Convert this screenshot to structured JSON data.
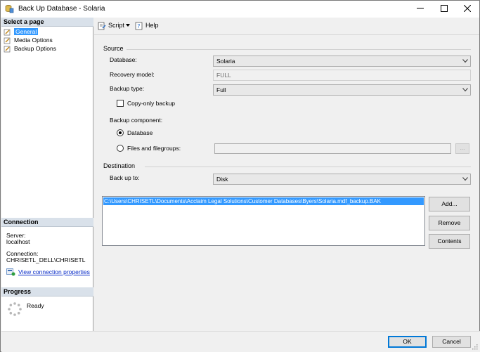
{
  "window": {
    "title": "Back Up Database - Solaria"
  },
  "sidebar": {
    "select_page_header": "Select a page",
    "pages": [
      {
        "label": "General",
        "selected": true
      },
      {
        "label": "Media Options",
        "selected": false
      },
      {
        "label": "Backup Options",
        "selected": false
      }
    ],
    "connection": {
      "header": "Connection",
      "server_label": "Server:",
      "server_value": "localhost",
      "connection_label": "Connection:",
      "connection_value": "CHRISETL_DELL\\CHRISETL",
      "view_link": "View connection properties"
    },
    "progress": {
      "header": "Progress",
      "status": "Ready"
    }
  },
  "toolbar": {
    "script_label": "Script",
    "help_label": "Help"
  },
  "source": {
    "section_label": "Source",
    "database_label": "Database:",
    "database_value": "Solaria",
    "recovery_label": "Recovery model:",
    "recovery_value": "FULL",
    "backup_type_label": "Backup type:",
    "backup_type_value": "Full",
    "copy_only_label": "Copy-only backup",
    "copy_only_checked": false,
    "component_label": "Backup component:",
    "component_database_label": "Database",
    "component_files_label": "Files and filegroups:",
    "component_selected": "Database",
    "files_button_label": "..."
  },
  "destination": {
    "section_label": "Destination",
    "back_up_to_label": "Back up to:",
    "back_up_to_value": "Disk",
    "paths": [
      "C:\\Users\\CHRISETL\\Documents\\Acclaim Legal Solutions\\Customer Databases\\Byers\\Solaria.mdf_backup.BAK"
    ],
    "add_button": "Add...",
    "remove_button": "Remove",
    "contents_button": "Contents"
  },
  "dialog": {
    "ok_button": "OK",
    "cancel_button": "Cancel"
  },
  "colors": {
    "selection": "#3399ff",
    "link": "#0b2ec8",
    "header_bg": "#d9e1ea"
  }
}
